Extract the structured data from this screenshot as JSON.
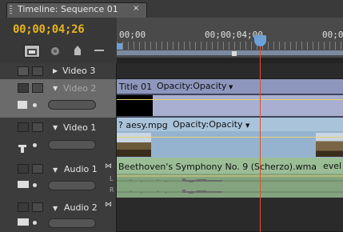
{
  "tab": {
    "title": "Timeline: Sequence 01",
    "close": "×"
  },
  "timecode": "00;00;04;26",
  "ruler": {
    "labels": [
      "00;00",
      "00;00;04;00",
      "00;0"
    ]
  },
  "tracks": {
    "video3": {
      "name": "Video 3"
    },
    "video2": {
      "name": "Video 2",
      "clip_name": "Title 01",
      "clip_param": "Opacity:Opacity"
    },
    "video1": {
      "name": "Video 1",
      "clip_name": "? aesy.mpg",
      "clip_param": "Opacity:Opacity"
    },
    "audio1": {
      "name": "Audio 1",
      "clip_name": "Beethoven's Symphony No. 9 (Scherzo).wma",
      "clip_extra": "evel",
      "ch_l": "L",
      "ch_r": "R"
    },
    "audio2": {
      "name": "Audio 2"
    }
  },
  "colors": {
    "timecode": "#e6b21f",
    "cti": "#e0502a",
    "audio_clip": "#8fb08a",
    "video_clip": "#a8c4dc",
    "title_clip": "#9aa6c8"
  }
}
